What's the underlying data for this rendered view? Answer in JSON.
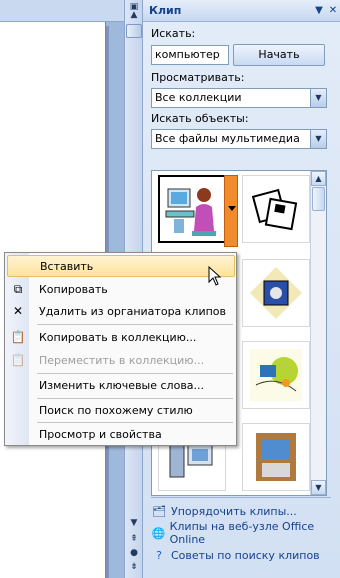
{
  "pane": {
    "title": "Клип",
    "search_label": "Искать:",
    "search_value": "компьютер",
    "start_button": "Начать",
    "browse_label": "Просматривать:",
    "browse_value": "Все коллекции",
    "objects_label": "Искать объекты:",
    "objects_value": "Все файлы мультимедиа",
    "links": [
      {
        "label": "Упорядочить клипы...",
        "icon": "organize-icon"
      },
      {
        "label": "Клипы на веб-узле Office Online",
        "icon": "globe-icon"
      },
      {
        "label": "Советы по поиску клипов",
        "icon": "help-icon"
      }
    ]
  },
  "context_menu": {
    "items": [
      {
        "label": "Вставить",
        "icon": "",
        "state": "highlighted"
      },
      {
        "label": "Копировать",
        "icon": "copy-icon",
        "state": "normal"
      },
      {
        "label": "Удалить из органиатора клипов",
        "icon": "delete-icon",
        "state": "normal"
      },
      {
        "label": "Копировать в коллекцию...",
        "icon": "copy-to-collection-icon",
        "state": "normal"
      },
      {
        "label": "Переместить в коллекцию...",
        "icon": "move-to-collection-icon",
        "state": "disabled"
      },
      {
        "label": "Изменить ключевые слова...",
        "icon": "",
        "state": "normal"
      },
      {
        "label": "Поиск по похожему стилю",
        "icon": "",
        "state": "normal"
      },
      {
        "label": "Просмотр и свойства",
        "icon": "",
        "state": "normal"
      }
    ]
  },
  "colors": {
    "accent_orange": "#f08c2d",
    "menu_highlight": "#fde39b",
    "link_blue": "#15428b"
  }
}
